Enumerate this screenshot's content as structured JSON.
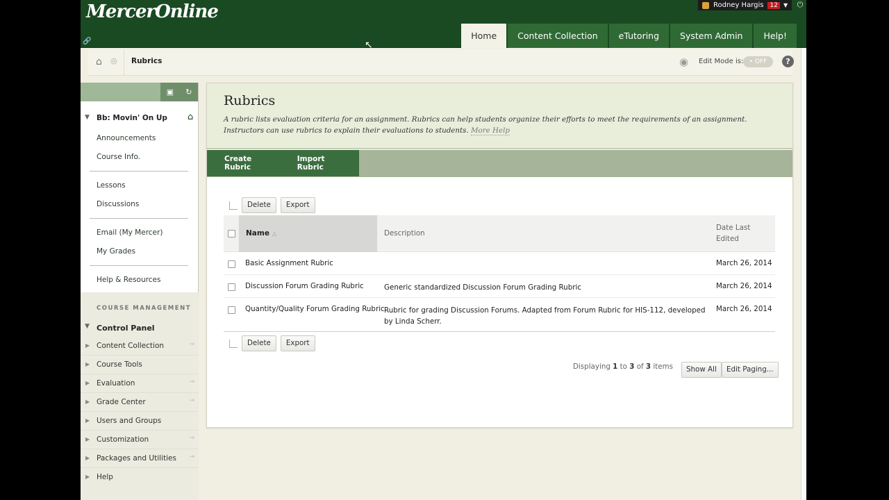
{
  "header": {
    "logo": "MercerOnline",
    "tabs": [
      "Home",
      "Content Collection",
      "eTutoring",
      "System Admin",
      "Help!"
    ]
  },
  "user": {
    "name": "Rodney Hargis",
    "notifications": "12"
  },
  "breadcrumb": {
    "current": "Rubrics"
  },
  "edit_mode": {
    "label": "Edit Mode is:",
    "state": "OFF"
  },
  "sidebar": {
    "course_title": "Bb: Movin' On Up",
    "group1": [
      "Announcements",
      "Course Info."
    ],
    "group2": [
      "Lessons",
      "Discussions"
    ],
    "group3": [
      "Email (My Mercer)",
      "My Grades"
    ],
    "group4": [
      "Help & Resources"
    ],
    "course_management_label": "COURSE MANAGEMENT",
    "control_panel_label": "Control Panel",
    "cm_items": [
      "Content Collection",
      "Course Tools",
      "Evaluation",
      "Grade Center",
      "Users and Groups",
      "Customization",
      "Packages and Utilities",
      "Help"
    ]
  },
  "page": {
    "title": "Rubrics",
    "description": "A rubric lists evaluation criteria for an assignment. Rubrics can help students organize their efforts to meet the requirements of an assignment. Instructors can use rubrics to explain their evaluations to students.",
    "more_help": "More Help",
    "actions": [
      "Create Rubric",
      "Import Rubric"
    ],
    "delete_label": "Delete",
    "export_label": "Export"
  },
  "table": {
    "columns": {
      "name": "Name",
      "description": "Description",
      "date_line1": "Date Last",
      "date_line2": "Edited"
    },
    "rows": [
      {
        "name": "Basic Assignment Rubric",
        "description": "",
        "date": "March 26, 2014"
      },
      {
        "name": "Discussion Forum Grading Rubric",
        "description": "Generic standardized Discussion Forum Grading Rubric",
        "date": "March 26, 2014"
      },
      {
        "name": "Quantity/Quality Forum Grading Rubric",
        "description": "Rubric for grading Discussion Forums.  Adapted from Forum Rubric for HIS-112, developed by Linda Scherr.",
        "date": "March 26, 2014"
      }
    ]
  },
  "paging": {
    "displaying": "Displaying",
    "from": "1",
    "to_word": "to",
    "to": "3",
    "of_word": "of",
    "total": "3",
    "items_word": "items",
    "show_all": "Show All",
    "edit_paging": "Edit Paging..."
  }
}
